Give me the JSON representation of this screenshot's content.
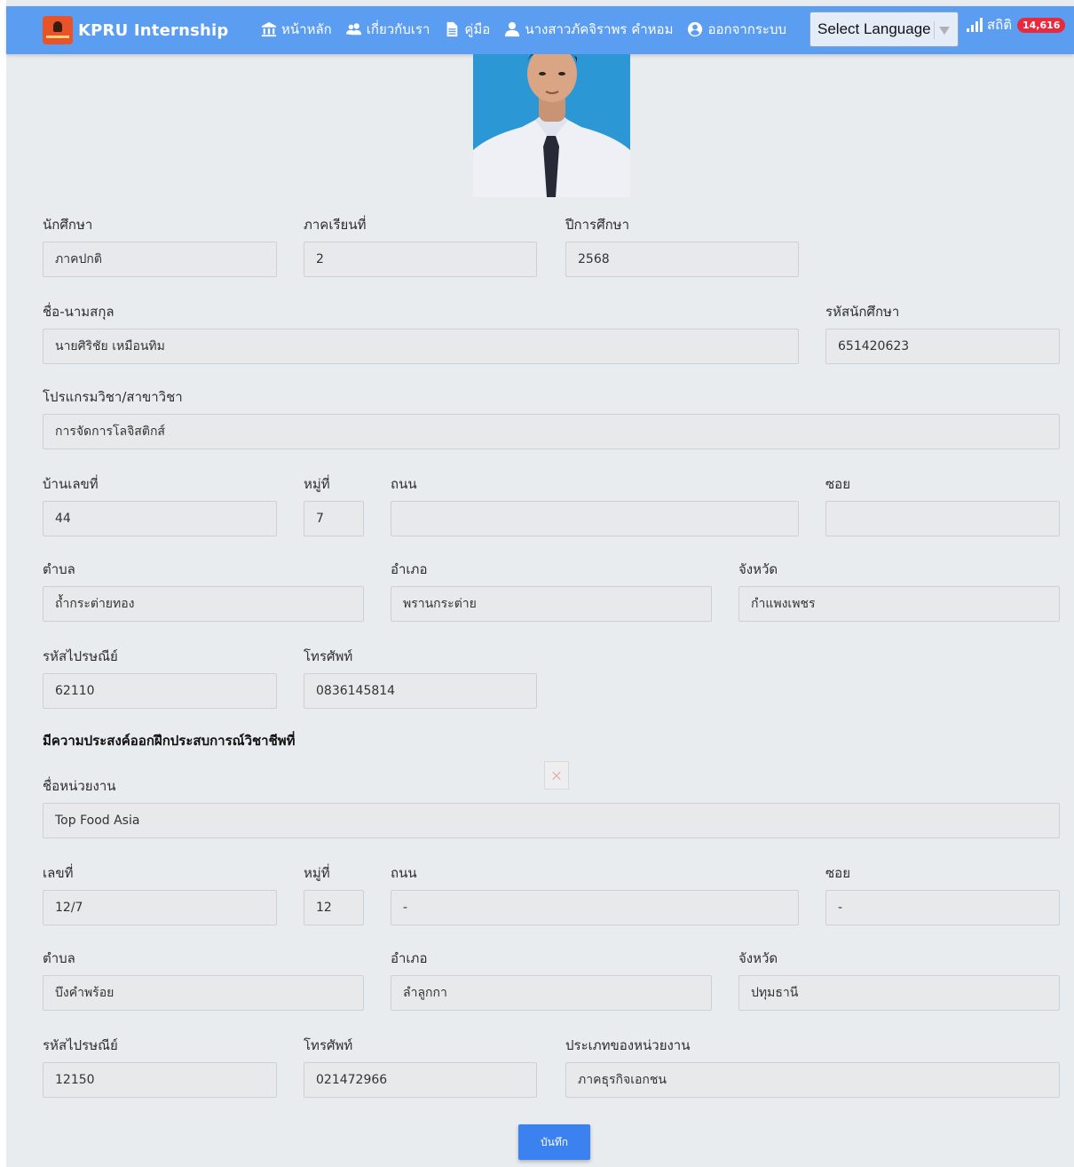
{
  "nav": {
    "brand": "KPRU Internship",
    "home": "หน้าหลัก",
    "about": "เกี่ยวกับเรา",
    "manual": "คู่มือ",
    "user": "นางสาวภัคจิราพร คำหอม",
    "logout": "ออกจากระบบ",
    "language": "Select Language",
    "stats": "สถิติ",
    "stats_count": "14,616"
  },
  "student": {
    "labels": {
      "type": "นักศึกษา",
      "semester": "ภาคเรียนที่",
      "year": "ปีการศึกษา",
      "name": "ชื่อ-นามสกุล",
      "student_id": "รหัสนักศึกษา",
      "program": "โปรแกรมวิชา/สาขาวิชา",
      "house_no": "บ้านเลขที่",
      "moo": "หมู่ที่",
      "road": "ถนน",
      "soi": "ซอย",
      "subdistrict": "ตำบล",
      "district": "อำเภอ",
      "province": "จังหวัด",
      "postcode": "รหัสไปรษณีย์",
      "phone": "โทรศัพท์"
    },
    "values": {
      "type": "ภาคปกติ",
      "semester": "2",
      "year": "2568",
      "name": "นายศิริชัย เหมือนทิม",
      "student_id": "651420623",
      "program": "การจัดการโลจิสติกส์",
      "house_no": "44",
      "moo": "7",
      "road": "",
      "soi": "",
      "subdistrict": "ถ้ำกระต่ายทอง",
      "district": "พรานกระต่าย",
      "province": "กำแพงเพชร",
      "postcode": "62110",
      "phone": "0836145814"
    }
  },
  "company": {
    "heading": "มีความประสงค์ออกฝึกประสบการณ์วิชาชีพที่",
    "labels": {
      "name": "ชื่อหน่วยงาน",
      "no": "เลขที่",
      "moo": "หมู่ที่",
      "road": "ถนน",
      "soi": "ซอย",
      "subdistrict": "ตำบล",
      "district": "อำเภอ",
      "province": "จังหวัด",
      "postcode": "รหัสไปรษณีย์",
      "phone": "โทรศัพท์",
      "org_type": "ประเภทของหน่วยงาน"
    },
    "values": {
      "name": "Top Food Asia",
      "no": "12/7",
      "moo": "12",
      "road": "-",
      "soi": "-",
      "subdistrict": "บึงคำพร้อย",
      "district": "ลำลูกกา",
      "province": "ปทุมธานี",
      "postcode": "12150",
      "phone": "021472966",
      "org_type": "ภาคธุรกิจเอกชน"
    }
  },
  "actions": {
    "save": "บันทึก"
  }
}
